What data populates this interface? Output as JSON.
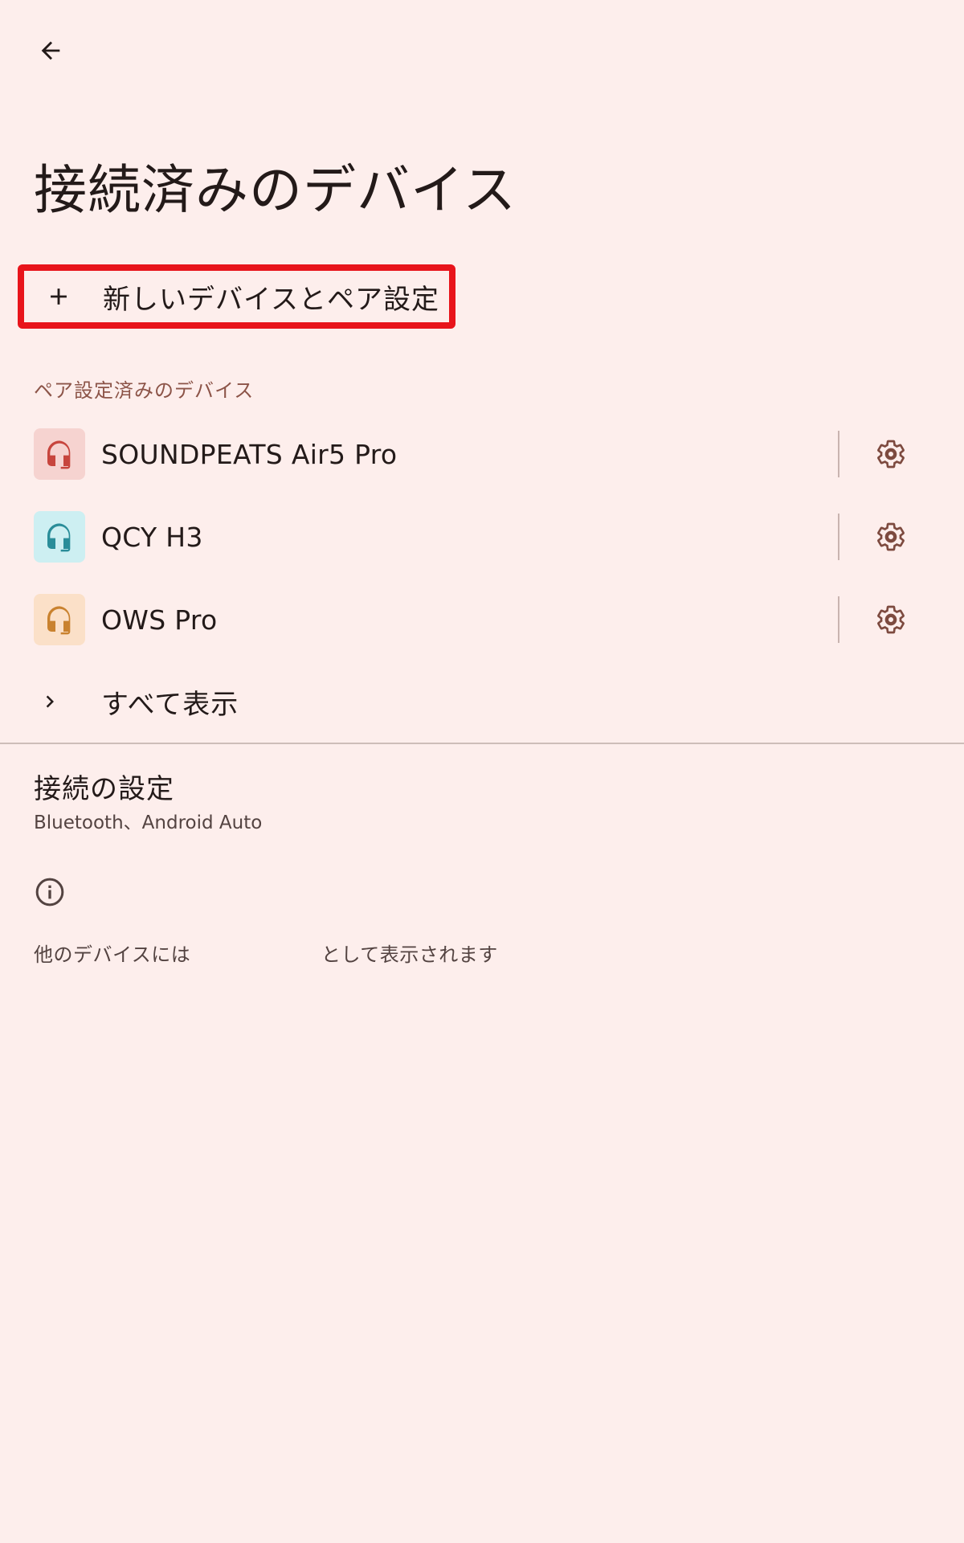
{
  "header": {
    "back_icon": "arrow-back-icon",
    "title": "接続済みのデバイス"
  },
  "pair_new": {
    "icon": "plus-icon",
    "label": "新しいデバイスとペア設定",
    "highlight_color": "#e8141b"
  },
  "paired_section": {
    "header": "ペア設定済みのデバイス",
    "devices": [
      {
        "name": "SOUNDPEATS Air5 Pro",
        "icon": "headset-icon",
        "icon_bg": "#f6d3d0",
        "icon_color": "#c7453d"
      },
      {
        "name": "QCY H3",
        "icon": "headset-icon",
        "icon_bg": "#cdeff2",
        "icon_color": "#2a8d99"
      },
      {
        "name": "OWS Pro",
        "icon": "headset-icon",
        "icon_bg": "#fbe0c8",
        "icon_color": "#c9822f"
      }
    ],
    "settings_icon": "gear-icon"
  },
  "show_all": {
    "icon": "chevron-right-icon",
    "label": "すべて表示"
  },
  "connection_settings": {
    "title": "接続の設定",
    "subtitle": "Bluetooth、Android Auto"
  },
  "info": {
    "icon": "info-icon",
    "text_before": "他のデバイスには",
    "text_after": "として表示されます"
  },
  "colors": {
    "background": "#fdeeec",
    "accent": "#8c5448",
    "gear": "#7d4a3f"
  }
}
